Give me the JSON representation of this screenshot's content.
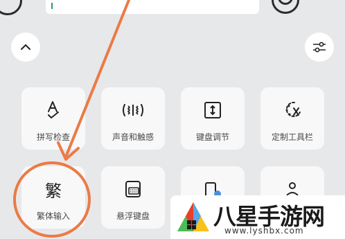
{
  "tiles": [
    {
      "label": "拼写检查",
      "icon": "spellcheck-icon"
    },
    {
      "label": "声音和触感",
      "icon": "sound-vibration-icon"
    },
    {
      "label": "键盘调节",
      "icon": "keyboard-resize-icon"
    },
    {
      "label": "定制工具栏",
      "icon": "customize-toolbar-icon"
    },
    {
      "label": "繁体输入",
      "icon_char": "繁"
    },
    {
      "label": "悬浮键盘",
      "icon": "floating-keyboard-icon"
    },
    {
      "label": "",
      "icon": "partial-icon"
    },
    {
      "label": "",
      "icon": "partial-icon"
    }
  ],
  "highlight_color": "#ec7a45",
  "watermark": {
    "title": "八星手游网",
    "url": "www.lyshbx.com"
  }
}
